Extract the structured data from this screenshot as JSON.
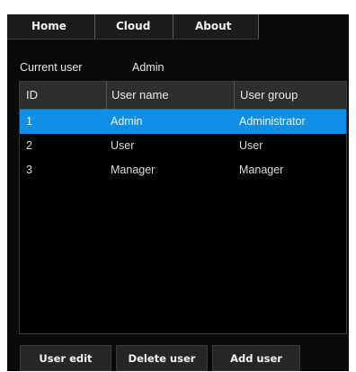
{
  "tabs": {
    "home": "Home",
    "cloud": "Cloud",
    "about": "About"
  },
  "current_user": {
    "label": "Current user",
    "value": "Admin"
  },
  "table": {
    "headers": {
      "id": "ID",
      "name": "User name",
      "group": "User group"
    },
    "rows": [
      {
        "id": "1",
        "name": "Admin",
        "group": "Administrator",
        "selected": true
      },
      {
        "id": "2",
        "name": "User",
        "group": "User",
        "selected": false
      },
      {
        "id": "3",
        "name": "Manager",
        "group": "Manager",
        "selected": false
      }
    ]
  },
  "buttons": {
    "edit": "User edit",
    "delete": "Delete user",
    "add": "Add user"
  },
  "colors": {
    "background": "#0a0a0a",
    "selection": "#0f8fe6",
    "header": "#2e2e2e"
  }
}
